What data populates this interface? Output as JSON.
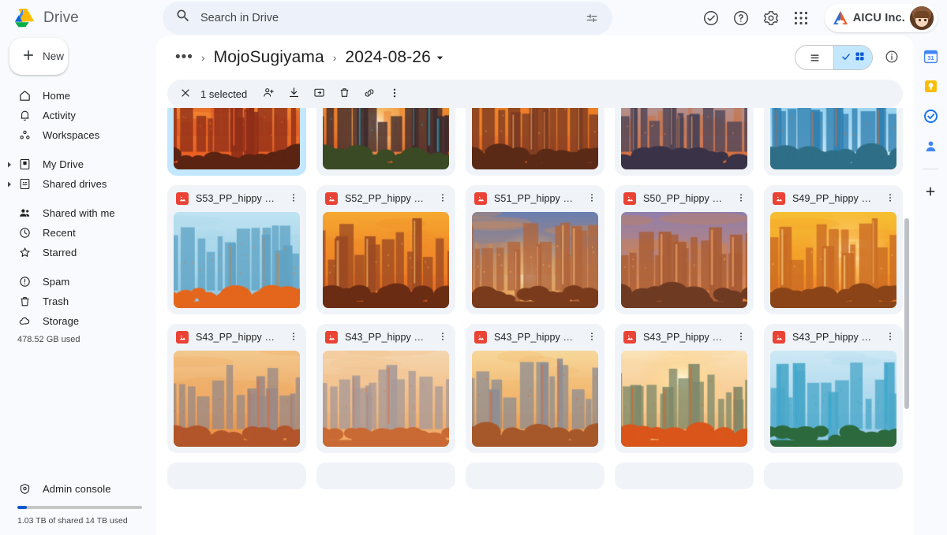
{
  "header": {
    "brand_name": "Drive",
    "logo_icon": "drive-logo",
    "search": {
      "placeholder": "Search in Drive",
      "value": "",
      "search_icon": "search-icon",
      "filter_icon": "tune-filter-icon"
    },
    "actions": [
      {
        "name": "support-status-icon",
        "label": "Support"
      },
      {
        "name": "help-icon",
        "label": "Help"
      },
      {
        "name": "gear-icon",
        "label": "Settings"
      },
      {
        "name": "apps-grid-icon",
        "label": "Google apps"
      }
    ],
    "account": {
      "org_name": "AICU Inc.",
      "logo_icon": "aicu-logo-icon",
      "avatar_icon": "user-avatar"
    }
  },
  "sidebar": {
    "new_button": {
      "label": "New",
      "icon": "plus-icon"
    },
    "groups": [
      {
        "items": [
          {
            "label": "Home",
            "icon": "home-icon",
            "expandable": false
          },
          {
            "label": "Activity",
            "icon": "bell-icon",
            "expandable": false
          },
          {
            "label": "Workspaces",
            "icon": "workspaces-icon",
            "expandable": false
          }
        ]
      },
      {
        "items": [
          {
            "label": "My Drive",
            "icon": "my-drive-icon",
            "expandable": true
          },
          {
            "label": "Shared drives",
            "icon": "shared-drives-icon",
            "expandable": true
          }
        ]
      },
      {
        "items": [
          {
            "label": "Shared with me",
            "icon": "people-icon",
            "expandable": false
          },
          {
            "label": "Recent",
            "icon": "clock-icon",
            "expandable": false
          },
          {
            "label": "Starred",
            "icon": "star-icon",
            "expandable": false
          }
        ]
      },
      {
        "items": [
          {
            "label": "Spam",
            "icon": "spam-icon",
            "expandable": false
          },
          {
            "label": "Trash",
            "icon": "trash-icon",
            "expandable": false
          },
          {
            "label": "Storage",
            "icon": "cloud-icon",
            "expandable": false
          }
        ]
      }
    ],
    "storage_used": "478.52 GB used",
    "admin_console": {
      "label": "Admin console",
      "icon": "admin-shield-icon"
    },
    "quota_text": "1.03 TB of shared 14 TB used",
    "quota_percent": 7.4,
    "quota_bar_color": "#0b57d0"
  },
  "breadcrumb": {
    "overflow": "•••",
    "items": [
      "MojoSugiyama",
      "2024-08-26"
    ],
    "dropdown_icon": "chevron-down-icon",
    "separator": "›"
  },
  "view_controls": {
    "list_view": {
      "name": "list-view-button",
      "icon": "list-icon",
      "active": false
    },
    "grid_view": {
      "name": "grid-view-button",
      "icon": "grid-icon",
      "active": true,
      "check_icon": "check-icon"
    },
    "details": {
      "name": "details-button",
      "icon": "info-icon"
    },
    "active_accent": "#c2e7ff"
  },
  "selection_toolbar": {
    "close_icon": "close-icon",
    "count_label": "1 selected",
    "actions": [
      {
        "name": "share-add-person-button",
        "icon": "person-add-icon"
      },
      {
        "name": "download-button",
        "icon": "download-icon"
      },
      {
        "name": "move-to-folder-button",
        "icon": "move-folder-icon"
      },
      {
        "name": "delete-button",
        "icon": "trash-icon"
      },
      {
        "name": "get-link-button",
        "icon": "link-icon"
      },
      {
        "name": "more-actions-button",
        "icon": "more-vertical-icon"
      }
    ]
  },
  "file_grid": {
    "file_type_icon": "image-file-icon",
    "file_type_color": "#ea4335",
    "more_icon": "more-vertical-icon",
    "selected_color": "#c2e7ff",
    "rows": [
      {
        "clipped": true,
        "cards": [
          {
            "title": "",
            "selected": true,
            "thumb": "city-red-sunset"
          },
          {
            "title": "",
            "selected": false,
            "thumb": "city-golden-avenue"
          },
          {
            "title": "",
            "selected": false,
            "thumb": "city-orange-haze"
          },
          {
            "title": "",
            "selected": false,
            "thumb": "city-dusk-towers"
          },
          {
            "title": "",
            "selected": false,
            "thumb": "city-blue-sky-glass"
          }
        ]
      },
      {
        "clipped": false,
        "cards": [
          {
            "title": "S53_PP_hippy st...",
            "selected": false,
            "thumb": "city-cyan-autumn"
          },
          {
            "title": "S52_PP_hippy st...",
            "selected": false,
            "thumb": "city-amber-blocks"
          },
          {
            "title": "S51_PP_hippy st...",
            "selected": false,
            "thumb": "city-planets-sunset"
          },
          {
            "title": "S50_PP_hippy st...",
            "selected": false,
            "thumb": "city-violet-glow"
          },
          {
            "title": "S49_PP_hippy st...",
            "selected": false,
            "thumb": "city-gold-tower"
          }
        ]
      },
      {
        "clipped": false,
        "cards": [
          {
            "title": "S43_PP_hippy st...",
            "selected": false,
            "thumb": "city-pale-orange"
          },
          {
            "title": "S43_PP_hippy st...",
            "selected": false,
            "thumb": "city-peach-skyline"
          },
          {
            "title": "S43_PP_hippy st...",
            "selected": false,
            "thumb": "city-canal-orange"
          },
          {
            "title": "S43_PP_hippy st...",
            "selected": false,
            "thumb": "lake-autumn-trees"
          },
          {
            "title": "S43_PP_hippy st...",
            "selected": false,
            "thumb": "jungle-blue-city"
          }
        ]
      }
    ]
  },
  "right_rail": {
    "apps": [
      {
        "name": "calendar-icon",
        "label": "Calendar"
      },
      {
        "name": "keep-icon",
        "label": "Keep"
      },
      {
        "name": "tasks-icon",
        "label": "Tasks"
      },
      {
        "name": "contacts-icon",
        "label": "Contacts"
      }
    ],
    "add_button": {
      "name": "add-app-button",
      "icon": "plus-icon"
    }
  }
}
